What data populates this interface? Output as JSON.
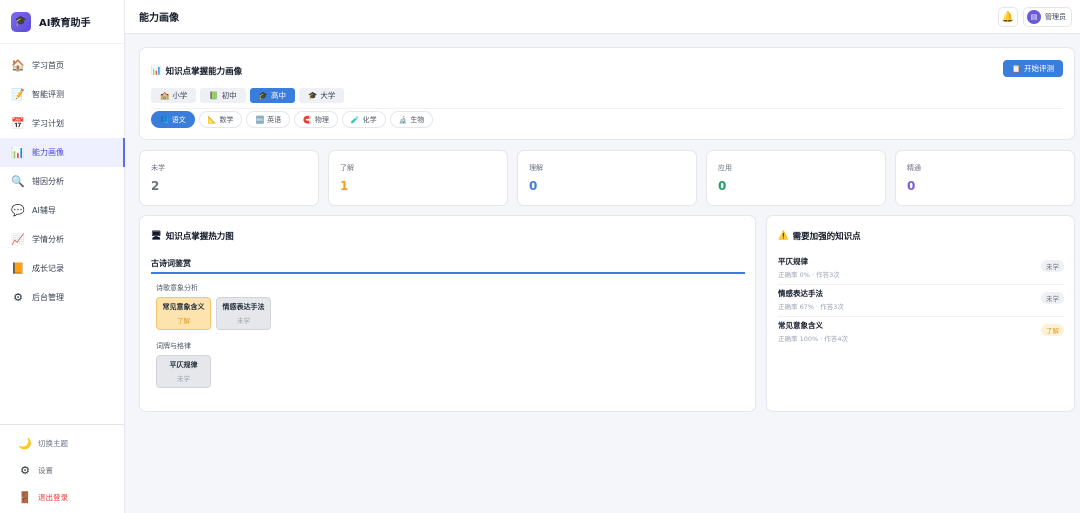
{
  "app": {
    "name": "AI教育助手"
  },
  "sidebar": {
    "items": [
      {
        "label": "学习首页",
        "icon": "home-icon",
        "glyph": "🏠"
      },
      {
        "label": "智能评测",
        "icon": "memo-icon",
        "glyph": "📝"
      },
      {
        "label": "学习计划",
        "icon": "calendar-icon",
        "glyph": "📅"
      },
      {
        "label": "能力画像",
        "icon": "bar-chart-icon",
        "glyph": "📊"
      },
      {
        "label": "错因分析",
        "icon": "magnifier-icon",
        "glyph": "🔍"
      },
      {
        "label": "AI辅导",
        "icon": "speech-bubble-icon",
        "glyph": "💬"
      },
      {
        "label": "学情分析",
        "icon": "trend-chart-icon",
        "glyph": "📈"
      },
      {
        "label": "成长记录",
        "icon": "notebook-icon",
        "glyph": "📙"
      },
      {
        "label": "后台管理",
        "icon": "gear-icon",
        "glyph": "⚙"
      }
    ],
    "active_index": 3,
    "bottom": {
      "theme": "切换主题",
      "settings": "设置",
      "logout": "退出登录"
    }
  },
  "header": {
    "title": "能力画像",
    "user": "管理员"
  },
  "filter": {
    "title": "知识点掌握能力画像",
    "start_button": "开始评测",
    "levels": [
      {
        "label": "小学",
        "glyph": "🏫"
      },
      {
        "label": "初中",
        "glyph": "📗"
      },
      {
        "label": "高中",
        "glyph": "🎓"
      },
      {
        "label": "大学",
        "glyph": "🎓"
      }
    ],
    "active_level": 2,
    "subjects": [
      {
        "label": "语文",
        "glyph": "📘"
      },
      {
        "label": "数学",
        "glyph": "📐"
      },
      {
        "label": "英语",
        "glyph": "🔤"
      },
      {
        "label": "物理",
        "glyph": "🧲"
      },
      {
        "label": "化学",
        "glyph": "🧪"
      },
      {
        "label": "生物",
        "glyph": "🔬"
      }
    ],
    "active_subject": 0
  },
  "stats": [
    {
      "label": "未学",
      "value": "2",
      "color": "#6b7280"
    },
    {
      "label": "了解",
      "value": "1",
      "color": "#f0a020"
    },
    {
      "label": "理解",
      "value": "0",
      "color": "#3b7ddd"
    },
    {
      "label": "应用",
      "value": "0",
      "color": "#22a06b"
    },
    {
      "label": "精通",
      "value": "0",
      "color": "#7c5cd6"
    }
  ],
  "heatmap": {
    "title": "知识点掌握热力图",
    "chapter": "古诗词鉴赏",
    "sections": [
      {
        "title": "诗歌意象分析",
        "points": [
          {
            "name": "常见意象含义",
            "level": "了解",
            "status": "learned"
          },
          {
            "name": "情感表达手法",
            "level": "未学",
            "status": "unlearned"
          }
        ]
      },
      {
        "title": "词牌与格律",
        "points": [
          {
            "name": "平仄规律",
            "level": "未学",
            "status": "unlearned"
          }
        ]
      }
    ]
  },
  "weak": {
    "title": "需要加强的知识点",
    "items": [
      {
        "name": "平仄规律",
        "meta": "正确率 0% · 作答3次",
        "badge": "未学",
        "status": "unlearned"
      },
      {
        "name": "情感表达手法",
        "meta": "正确率 67% · 作答3次",
        "badge": "未学",
        "status": "unlearned"
      },
      {
        "name": "常见意象含义",
        "meta": "正确率 100% · 作答4次",
        "badge": "了解",
        "status": "learned"
      }
    ]
  }
}
